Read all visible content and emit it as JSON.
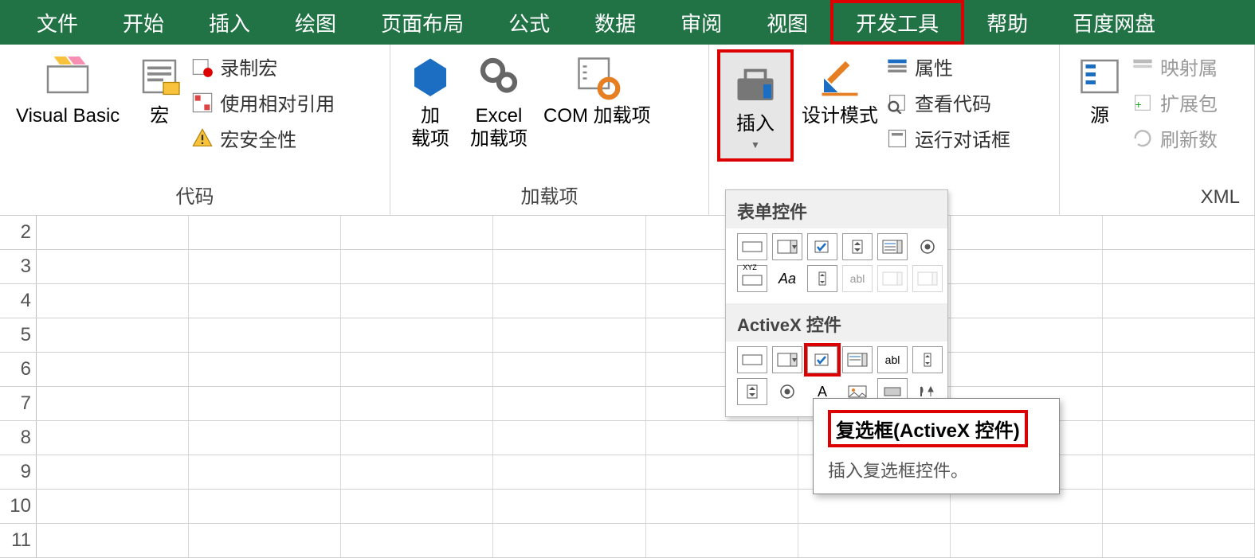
{
  "menubar": {
    "tabs": [
      "文件",
      "开始",
      "插入",
      "绘图",
      "页面布局",
      "公式",
      "数据",
      "审阅",
      "视图",
      "开发工具",
      "帮助",
      "百度网盘"
    ],
    "active_index": 9,
    "highlight_index": 9
  },
  "ribbon": {
    "group_code": {
      "label": "代码",
      "visual_basic": "Visual Basic",
      "macros": "宏",
      "record_macro": "录制宏",
      "use_relative": "使用相对引用",
      "macro_security": "宏安全性"
    },
    "group_addins": {
      "label": "加载项",
      "addins": "加\n载项",
      "excel_addins": "Excel\n加载项",
      "com_addins": "COM 加载项"
    },
    "group_controls": {
      "insert": "插入",
      "design_mode": "设计模式",
      "properties": "属性",
      "view_code": "查看代码",
      "run_dialog": "运行对话框"
    },
    "group_xml": {
      "label": "XML",
      "source": "源",
      "map_props": "映射属",
      "expand": "扩展包",
      "refresh": "刷新数"
    }
  },
  "controls_panel": {
    "form_title": "表单控件",
    "activex_title": "ActiveX 控件",
    "label_text": "Aa",
    "abl_text": "abl",
    "xyz_text": "XYZ"
  },
  "tooltip": {
    "title": "复选框(ActiveX 控件)",
    "body": "插入复选框控件。"
  },
  "rows": [
    "2",
    "3",
    "4",
    "5",
    "6",
    "7",
    "8",
    "9",
    "10",
    "11"
  ]
}
